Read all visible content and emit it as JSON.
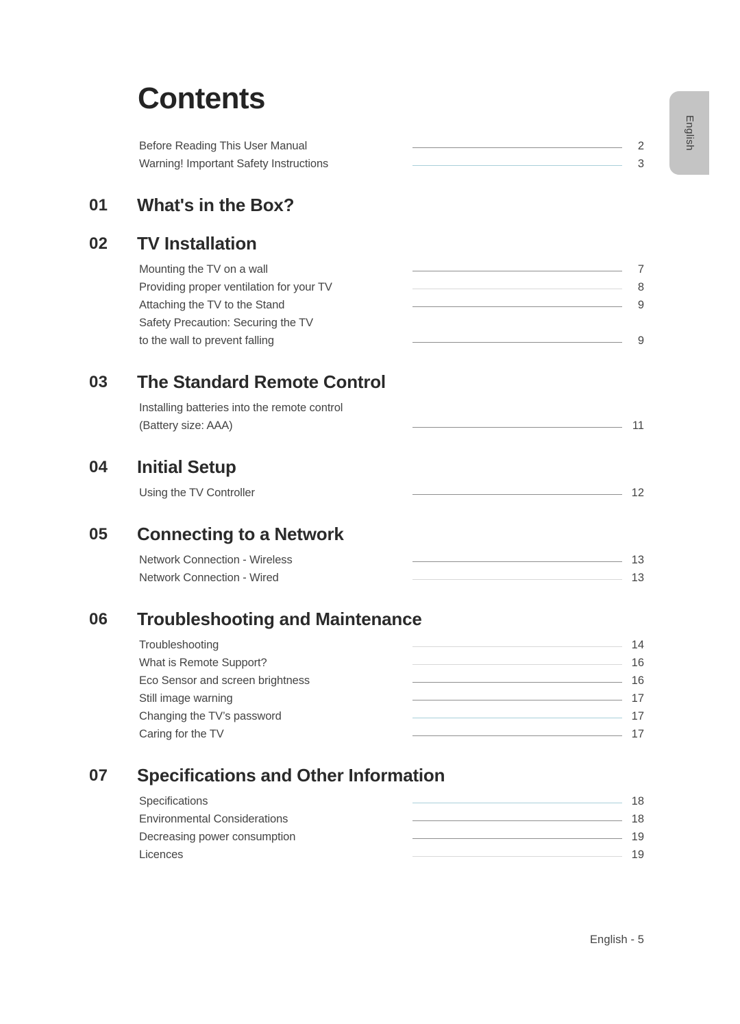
{
  "page_title": "Contents",
  "language_tab": {
    "label": "English"
  },
  "footer": {
    "text": "English - 5"
  },
  "intro_entries": [
    {
      "label": "Before Reading This User Manual",
      "page": "2",
      "leader": "gray"
    },
    {
      "label": "Warning! Important Safety Instructions",
      "page": "3",
      "leader": "blue"
    }
  ],
  "sections": [
    {
      "number": "01",
      "title": "What's in the Box?",
      "entries": []
    },
    {
      "number": "02",
      "title": "TV Installation",
      "entries": [
        {
          "label": "Mounting the TV on a wall",
          "page": "7",
          "leader": "gray"
        },
        {
          "label": "Providing proper ventilation for your TV",
          "page": "8",
          "leader": "light"
        },
        {
          "label": "Attaching the TV to the Stand",
          "page": "9",
          "leader": "gray"
        },
        {
          "label": "Safety Precaution: Securing the TV",
          "page": "",
          "leader": "none"
        },
        {
          "label": "to the wall to prevent falling",
          "page": "9",
          "leader": "gray"
        }
      ]
    },
    {
      "number": "03",
      "title": "The Standard Remote Control",
      "entries": [
        {
          "label": "Installing batteries into the remote control",
          "page": "",
          "leader": "none"
        },
        {
          "label": "(Battery size: AAA)",
          "page": "11",
          "leader": "gray"
        }
      ]
    },
    {
      "number": "04",
      "title": "Initial Setup",
      "entries": [
        {
          "label": "Using the TV Controller",
          "page": "12",
          "leader": "gray"
        }
      ]
    },
    {
      "number": "05",
      "title": "Connecting to a Network",
      "entries": [
        {
          "label": "Network Connection - Wireless",
          "page": "13",
          "leader": "gray"
        },
        {
          "label": "Network Connection - Wired",
          "page": "13",
          "leader": "light"
        }
      ]
    },
    {
      "number": "06",
      "title": "Troubleshooting and Maintenance",
      "entries": [
        {
          "label": "Troubleshooting",
          "page": "14",
          "leader": "light"
        },
        {
          "label": "What is Remote Support?",
          "page": "16",
          "leader": "light"
        },
        {
          "label": "Eco Sensor and screen brightness",
          "page": "16",
          "leader": "gray"
        },
        {
          "label": "Still image warning",
          "page": "17",
          "leader": "gray"
        },
        {
          "label": "Changing the TV’s password",
          "page": "17",
          "leader": "blue"
        },
        {
          "label": "Caring for the TV",
          "page": "17",
          "leader": "gray"
        }
      ]
    },
    {
      "number": "07",
      "title": "Specifications and Other Information",
      "entries": [
        {
          "label": "Specifications",
          "page": "18",
          "leader": "blue"
        },
        {
          "label": "Environmental Considerations",
          "page": "18",
          "leader": "gray"
        },
        {
          "label": "Decreasing power consumption",
          "page": "19",
          "leader": "gray"
        },
        {
          "label": "Licences",
          "page": "19",
          "leader": "light"
        }
      ]
    }
  ]
}
